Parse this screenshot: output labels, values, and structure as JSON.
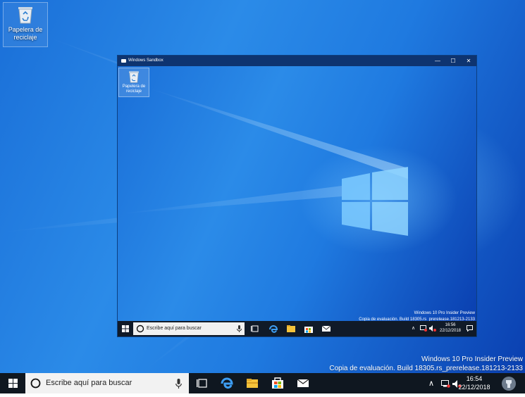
{
  "desktop": {
    "recycle_bin_label": "Papelera de reciclaje",
    "watermark_line1": "Windows 10 Pro Insider Preview",
    "watermark_line2": "Copia de evaluación. Build 18305.rs_prerelease.181213-2133"
  },
  "sandbox": {
    "title": "Windows Sandbox",
    "minimize": "—",
    "maximize": "☐",
    "close": "✕",
    "recycle_bin_label": "Papelera de reciclaje",
    "watermark_line1": "Windows 10 Pro Insider Preview",
    "watermark_line2": "Copia de evaluación. Build 18305.rs_prerelease.181213-2133",
    "search_placeholder": "Escribe aquí para buscar",
    "time": "16:56",
    "date": "22/12/2018"
  },
  "taskbar": {
    "search_placeholder": "Escribe aquí para buscar",
    "time": "16:54",
    "date": "22/12/2018"
  },
  "colors": {
    "accent": "#1a6fd8",
    "taskbar": "#0f1720"
  }
}
